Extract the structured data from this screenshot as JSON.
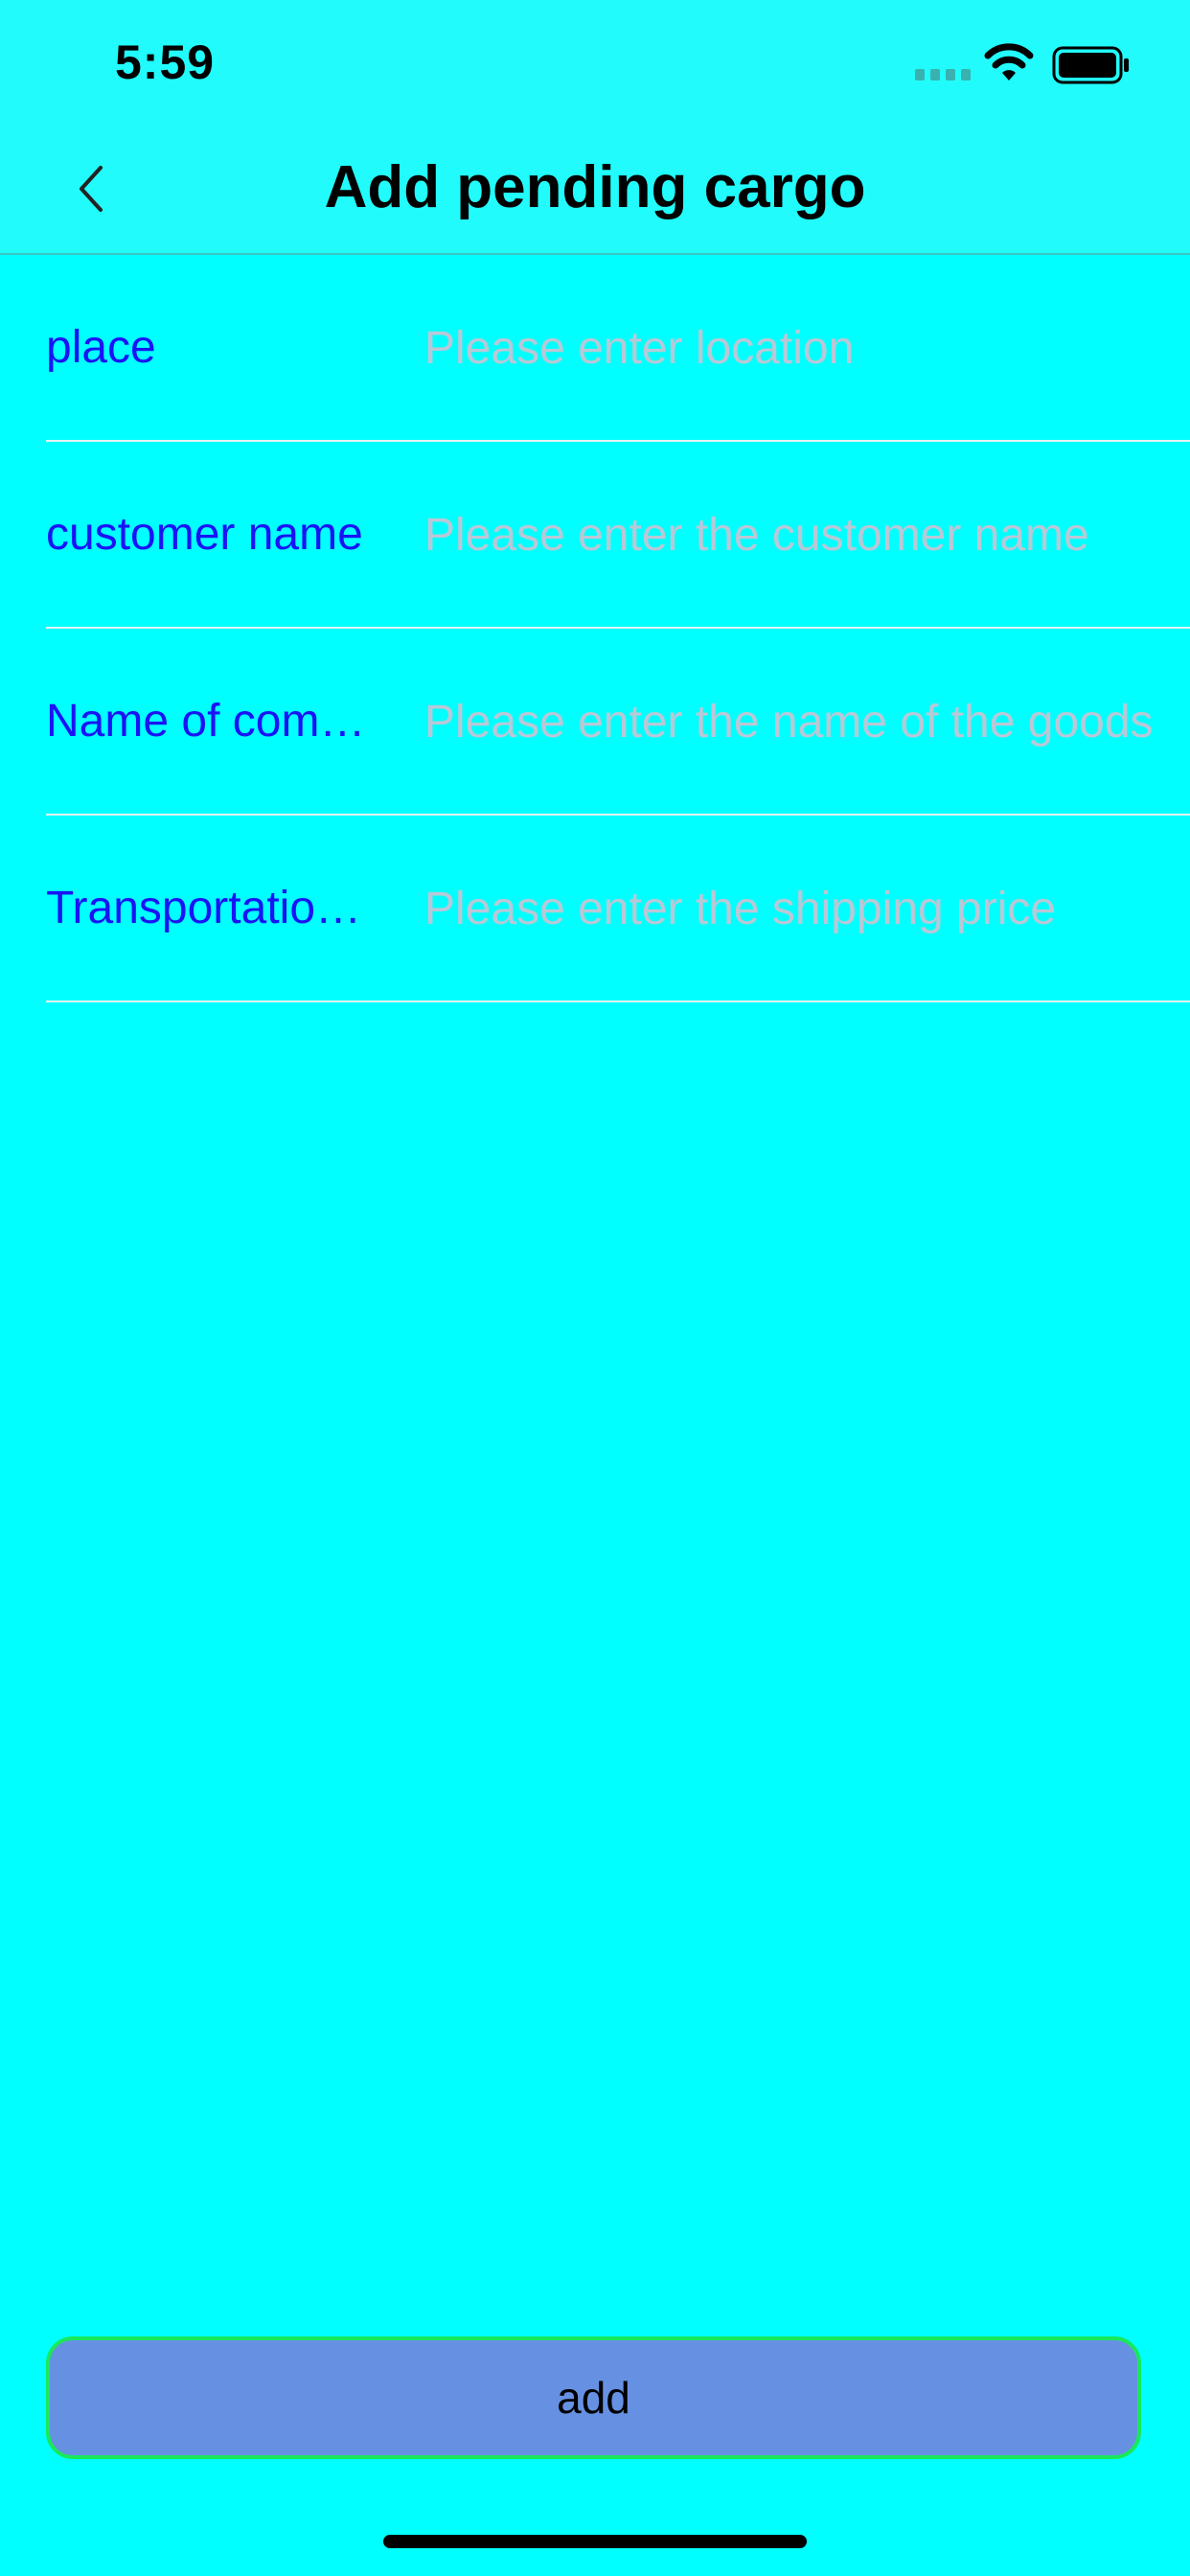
{
  "status_bar": {
    "time": "5:59"
  },
  "nav": {
    "title": "Add pending cargo",
    "back_icon": "chevron-left-icon"
  },
  "form": {
    "rows": [
      {
        "label": "place",
        "placeholder": "Please enter location",
        "value": ""
      },
      {
        "label": "customer name",
        "placeholder": "Please enter the customer name",
        "value": ""
      },
      {
        "label": "Name of commodity",
        "placeholder": "Please enter the name of the goods",
        "value": ""
      },
      {
        "label": "Transportation price",
        "placeholder": "Please enter the shipping price",
        "value": ""
      }
    ]
  },
  "actions": {
    "add_label": "add"
  },
  "colors": {
    "background": "#00ffff",
    "header_background": "#22fbfb",
    "label": "#1a14f5",
    "placeholder": "#b9c8d6",
    "button_fill": "#6691e3",
    "button_border": "#19e85b"
  }
}
